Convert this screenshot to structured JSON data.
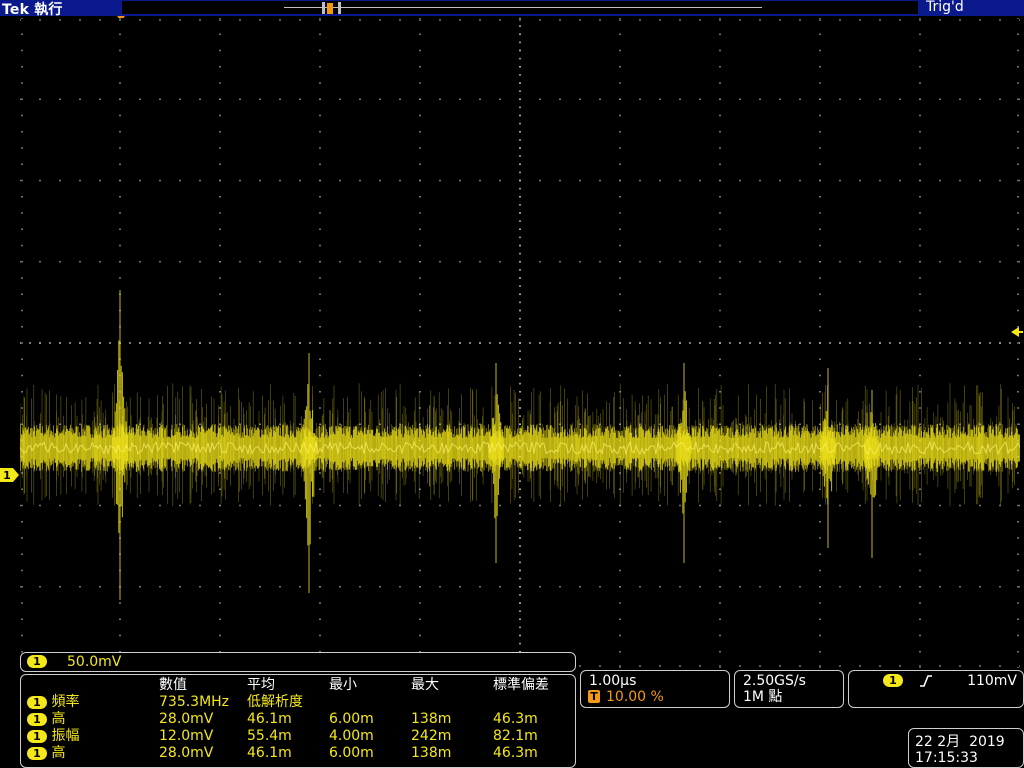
{
  "header": {
    "brand": "Tek",
    "mode": "執行",
    "status": "Trig'd"
  },
  "channel": {
    "number": "1",
    "scale": "50.0mV"
  },
  "measurements": {
    "columns": [
      "數值",
      "平均",
      "最小",
      "最大",
      "標準偏差"
    ],
    "rows": [
      {
        "ch": "1",
        "name": "頻率",
        "value": "735.3MHz",
        "mean": "低解析度",
        "min": "",
        "max": "",
        "std": ""
      },
      {
        "ch": "1",
        "name": "高",
        "value": "28.0mV",
        "mean": "46.1m",
        "min": "6.00m",
        "max": "138m",
        "std": "46.3m"
      },
      {
        "ch": "1",
        "name": "振幅",
        "value": "12.0mV",
        "mean": "55.4m",
        "min": "4.00m",
        "max": "242m",
        "std": "82.1m"
      },
      {
        "ch": "1",
        "name": "高",
        "value": "28.0mV",
        "mean": "46.1m",
        "min": "6.00m",
        "max": "138m",
        "std": "46.3m"
      }
    ]
  },
  "timebase": {
    "scale": "1.00µs",
    "trigger_marker": "T",
    "trigger_position": "10.00 %"
  },
  "acquisition": {
    "sample_rate": "2.50GS/s",
    "record_length": "1M 點"
  },
  "trigger": {
    "source": "1",
    "slope_icon": "rising-edge-icon",
    "level": "110mV"
  },
  "datetime": {
    "date": "22 2月  2019",
    "time": "17:15:33"
  },
  "markers": {
    "trigger_top": "T",
    "ch1_ground": "1"
  },
  "colors": {
    "trace": "#f4e71a",
    "topbar": "#0a1a8c",
    "trigger_orange": "#f39a12",
    "grid": "#9a9a9a"
  }
}
